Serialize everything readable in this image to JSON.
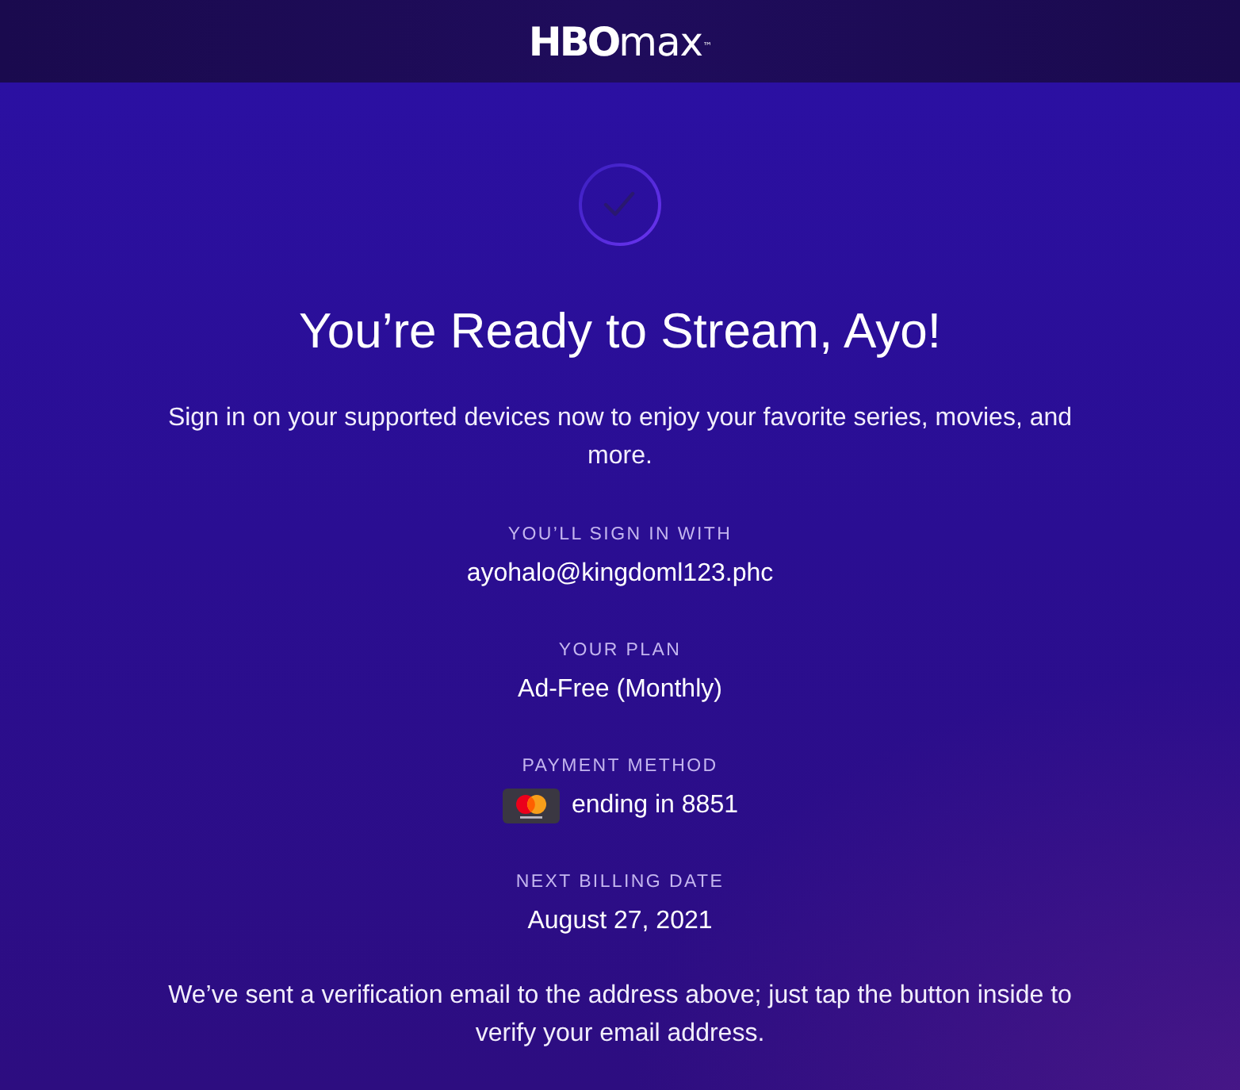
{
  "header": {
    "logo": "**HBO**max$^{™}$"
  },
  "title": "You’re Ready to Stream, Ayo!",
  "intro": "Sign in on your supported devices now to enjoy your favorite series, movies, and more.",
  "details": [
    {
      "kind": "text",
      "label": "YOU’LL SIGN IN WITH",
      "value": "ayohalo@kingdoml123.phc"
    },
    {
      "kind": "text",
      "label": "YOUR PLAN",
      "value": "Ad-Free (Monthly)"
    },
    {
      "kind": "card",
      "label": "PAYMENT METHOD",
      "value": "ending in 8851"
    },
    {
      "kind": "text",
      "label": "NEXT BILLING DATE",
      "value": "August 27, 2021"
    }
  ],
  "note": "We’ve sent a verification email to the address above; just tap the button inside to verify your email address."
}
